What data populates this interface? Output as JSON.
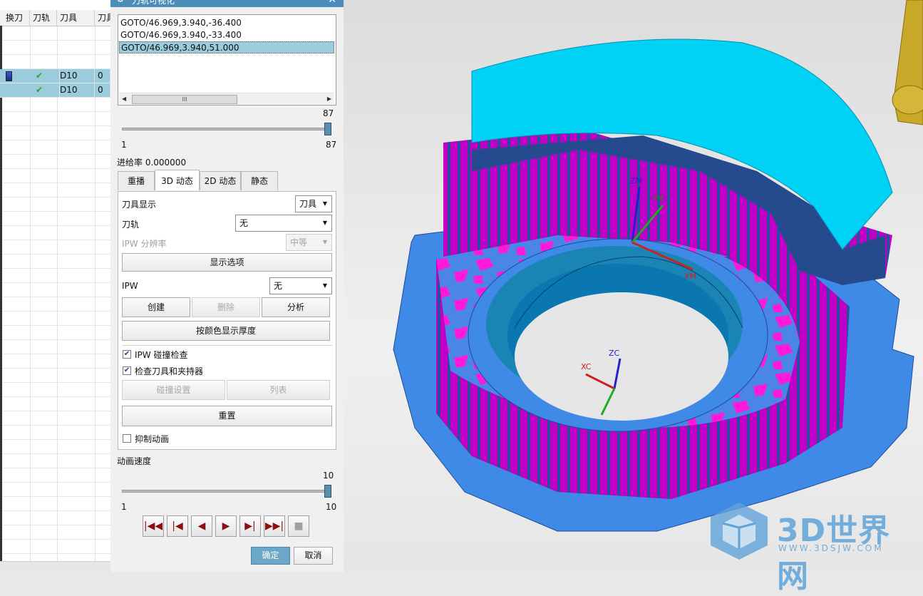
{
  "navigator": {
    "headers": [
      "换刀",
      "刀轨",
      "刀具",
      "刀具"
    ],
    "rows": [
      {
        "tool": "D10",
        "num": "0",
        "selected": true,
        "has_icon": true
      },
      {
        "tool": "D10",
        "num": "0",
        "selected": true,
        "has_icon": false
      }
    ]
  },
  "dialog": {
    "title": "刀轨可视化",
    "close": "✕",
    "toolpath_lines": [
      "GOTO/46.969,3.940,-36.400",
      "GOTO/46.969,3.940,-33.400",
      "GOTO/46.969,3.940,51.000"
    ],
    "selected_line": 2,
    "scroll_thumb_label": "III",
    "line_slider": {
      "value_label": "87",
      "min_label": "1",
      "max_label": "87",
      "fraction": 1.0
    },
    "feed_rate": "进给率 0.000000",
    "tabs": [
      "重播",
      "3D 动态",
      "2D 动态",
      "静态"
    ],
    "active_tab": 1,
    "panel": {
      "tool_display_label": "刀具显示",
      "tool_display_value": "刀具",
      "toolpath_label": "刀轨",
      "toolpath_value": "无",
      "ipw_resolution_label": "IPW 分辨率",
      "ipw_resolution_value": "中等",
      "display_options": "显示选项",
      "ipw_label": "IPW",
      "ipw_value": "无",
      "create": "创建",
      "delete": "删除",
      "analyze": "分析",
      "thickness_by_color": "按颜色显示厚度",
      "ipw_collision_check": "IPW 碰撞检查",
      "check_tool_holder": "检查刀具和夹持器",
      "collision_settings": "碰撞设置",
      "list": "列表",
      "reset": "重置",
      "suppress_animation": "抑制动画"
    },
    "anim_speed_label": "动画速度",
    "speed_slider": {
      "value_label": "10",
      "min_label": "1",
      "max_label": "10",
      "fraction": 1.0
    },
    "playback": [
      "⏮",
      "⏪",
      "◀",
      "▶",
      "⏩",
      "⏭",
      "■"
    ],
    "ok": "确定",
    "cancel": "取消"
  },
  "viewport": {
    "axes": {
      "zm": "ZM",
      "ym": "YM",
      "xm": "XM",
      "zc": "ZC",
      "xc": "XC"
    },
    "watermark_big": "3D世界网",
    "watermark_small": "WWW.3DSJW.COM",
    "colors": {
      "top": "#00d2f5",
      "base": "#3f8ae6",
      "wall": "#c000c8",
      "inner": "#1a85b5"
    }
  }
}
